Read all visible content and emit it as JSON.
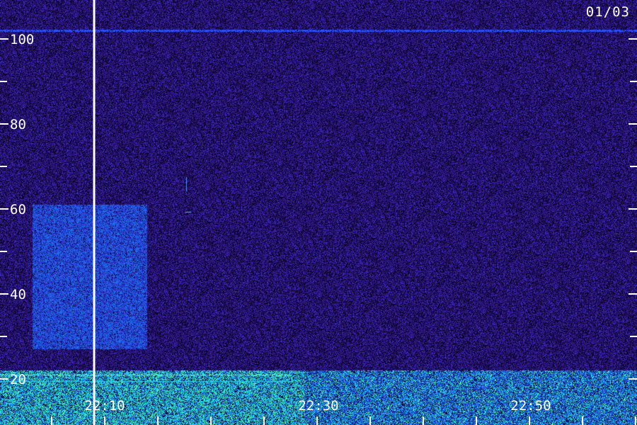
{
  "date_label": "01/03",
  "colors": {
    "background": "#2a0f6a",
    "noise_high": "#3a1ed8",
    "signal_blue": "#1e5cff",
    "signal_cyan": "#19d4e8",
    "signal_green": "#4dff7a",
    "cursor": "#ffffff"
  },
  "chart_data": {
    "type": "heatmap",
    "title": "",
    "xlabel": "",
    "ylabel": "",
    "x_tick_labels": [
      "22:10",
      "22:30",
      "22:50"
    ],
    "y_tick_labels": [
      "100",
      "80",
      "60",
      "40",
      "20"
    ],
    "ylim": [
      15,
      105
    ],
    "y_minor_ticks": [
      30,
      50,
      70,
      90
    ],
    "grid": false,
    "features": [
      {
        "name": "horizontal band",
        "frequency": 102
      },
      {
        "name": "burst region",
        "frequency_range": [
          27,
          61
        ]
      },
      {
        "name": "strong low-frequency band",
        "frequency_range": [
          15,
          22
        ]
      }
    ],
    "cursor": {
      "visible": true
    }
  }
}
